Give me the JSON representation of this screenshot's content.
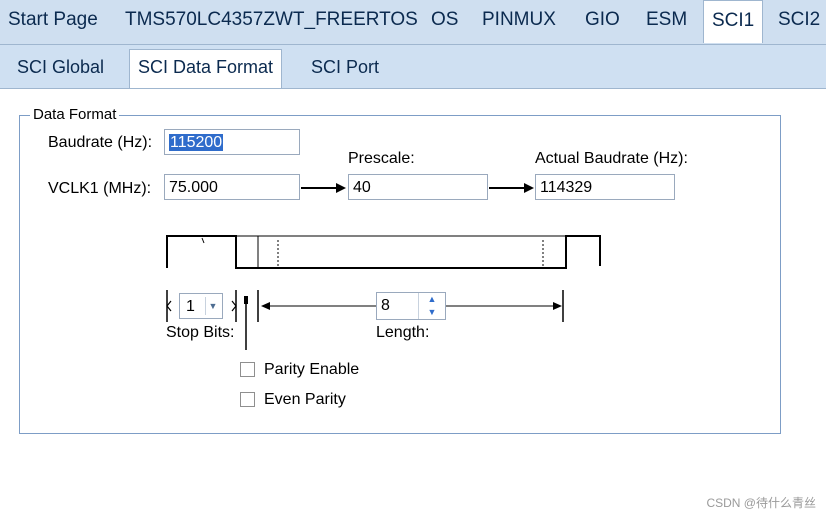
{
  "top_tabs": [
    "Start Page",
    "TMS570LC4357ZWT_FREERTOS",
    "OS",
    "PINMUX",
    "GIO",
    "ESM",
    "SCI1",
    "SCI2"
  ],
  "active_top_tab": "SCI1",
  "sub_tabs": [
    "SCI Global",
    "SCI Data Format",
    "SCI Port"
  ],
  "active_sub_tab": "SCI Data Format",
  "group_title": "Data Format",
  "baudrate": {
    "label": "Baudrate (Hz):",
    "value": "115200"
  },
  "vclk1": {
    "label": "VCLK1 (MHz):",
    "value": "75.000"
  },
  "prescale": {
    "label": "Prescale:",
    "value": "40"
  },
  "actual_baudrate": {
    "label": "Actual Baudrate (Hz):",
    "value": "114329"
  },
  "stop_bits": {
    "label": "Stop Bits:",
    "value": "1"
  },
  "length": {
    "label": "Length:",
    "value": "8"
  },
  "parity_enable": {
    "label": "Parity Enable",
    "checked": false
  },
  "even_parity": {
    "label": "Even Parity",
    "checked": false
  },
  "watermark": "CSDN @待什么青丝",
  "colors": {
    "accent": "#2f6ccb",
    "tab_bar": "#cfdff0",
    "border": "#7d9dc6"
  }
}
